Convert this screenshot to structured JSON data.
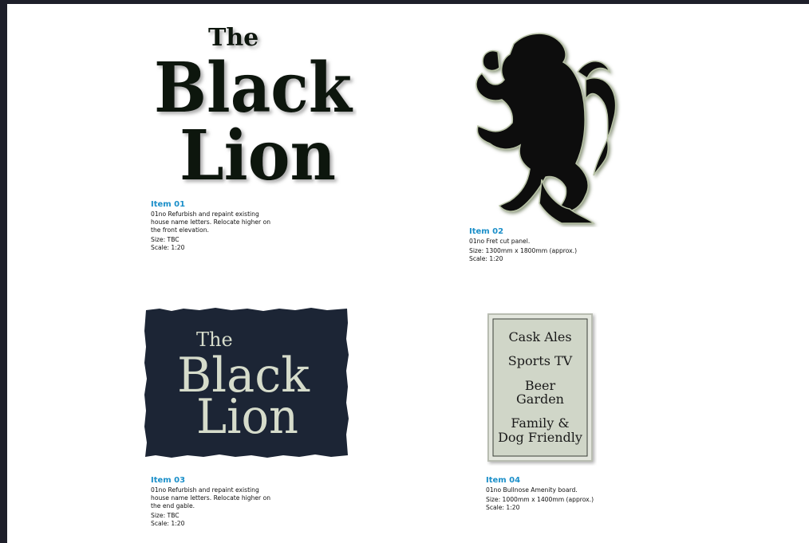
{
  "items": [
    {
      "title": "Item 01",
      "description": "01no Refurbish and repaint existing\nhouse name letters. Relocate higher on\nthe front elevation.",
      "size": "Size: TBC",
      "scale": "Scale: 1:20"
    },
    {
      "title": "Item 02",
      "description": "01no Fret cut panel.",
      "size": "Size: 1300mm x 1800mm (approx.)",
      "scale": "Scale: 1:20"
    },
    {
      "title": "Item 03",
      "description": "01no Refurbish and repaint existing\nhouse name letters. Relocate higher on\nthe end gable.",
      "size": "Size: TBC",
      "scale": "Scale: 1:20"
    },
    {
      "title": "Item 04",
      "description": "01no Bullnose Amenity board.",
      "size": "Size: 1000mm x 1400mm (approx.)",
      "scale": "Scale: 1:20"
    }
  ],
  "logo": {
    "the": "The",
    "black": "Black",
    "lion": "Lion"
  },
  "board": {
    "line1": "Cask Ales",
    "line2": "Sports TV",
    "line3a": "Beer",
    "line3b": "Garden",
    "line4a": "Family &",
    "line4b": "Dog Friendly"
  },
  "colors": {
    "accent": "#1b8fc9",
    "panel_navy": "#1c2535",
    "cream": "#d6dccb",
    "lion_black": "#0d100e",
    "board_bg": "#d0d6c8"
  }
}
